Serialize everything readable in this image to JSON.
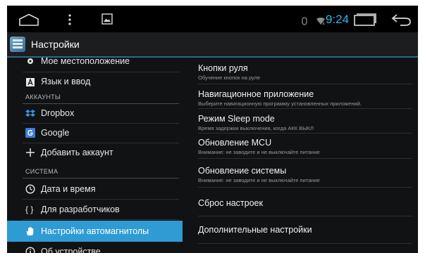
{
  "status_bar": {
    "time": "9:24",
    "icons": [
      "home-icon",
      "menu-icon",
      "screenshot-icon",
      "volume-icon",
      "wifi-icon",
      "recent-apps-icon",
      "back-icon"
    ],
    "accent_color": "#34b4e4"
  },
  "action_bar": {
    "title": "Настройки",
    "icon": "settings-app-icon"
  },
  "left_menu": {
    "items": [
      {
        "label": "Мое местоположение",
        "icon": "location-icon"
      },
      {
        "label": "Язык и ввод",
        "icon": "keyboard-icon"
      },
      {
        "header": "АККАУНТЫ"
      },
      {
        "label": "Dropbox",
        "icon": "dropbox-icon"
      },
      {
        "label": "Google",
        "icon": "google-icon"
      },
      {
        "label": "Добавить аккаунт",
        "icon": "plus-icon"
      },
      {
        "header": "СИСТЕМА"
      },
      {
        "label": "Дата и время",
        "icon": "clock-icon"
      },
      {
        "label": "Для разработчиков",
        "icon": "braces-icon"
      },
      {
        "label": "Настройки автомагнитолы",
        "icon": "hand-icon",
        "selected": true
      },
      {
        "label": "Об устройстве",
        "icon": "info-icon"
      }
    ],
    "selected_color": "#2f9bd3"
  },
  "right_panel": {
    "items": [
      {
        "title": "Кнопки руля",
        "subtitle": "Обучение кнопок на руле"
      },
      {
        "title": "Навигационное приложение",
        "subtitle": "Выберите навигационную программу установленных приложений."
      },
      {
        "title": "Режим Sleep mode",
        "subtitle": "Время задержки выключения, когда АКК ВЫКЛ"
      },
      {
        "title": "Обновление MCU",
        "subtitle": "Внимание: не заводите и не выключайте питание"
      },
      {
        "title": "Обновление системы",
        "subtitle": "Внимание: не заводите и не выключайте питание"
      },
      {
        "title": "Сброс настроек"
      },
      {
        "title": "Дополнительные настройки"
      }
    ]
  }
}
